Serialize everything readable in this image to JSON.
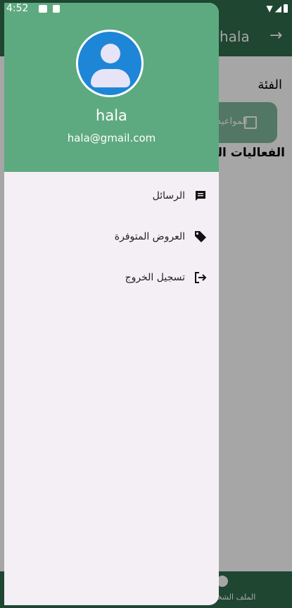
{
  "status_bar": {
    "time": "4:52"
  },
  "background_app": {
    "title": "hala",
    "category_label": "الفئة",
    "chip_label": "المواعيد",
    "events_heading": "الفعاليات القادمة",
    "bottom_nav_label": "الملف الشخصي"
  },
  "drawer": {
    "user_name": "hala",
    "user_email": "hala@gmail.com",
    "items": [
      {
        "label": "الرسائل",
        "icon": "message-icon"
      },
      {
        "label": "العروض المتوفرة",
        "icon": "tag-icon"
      },
      {
        "label": "تسجيل الخروج",
        "icon": "logout-icon"
      }
    ]
  },
  "colors": {
    "header": "#5eaa80",
    "app_bar": "#2f6c4c",
    "avatar": "#1e86d7",
    "drawer_bg": "#f4eff4"
  }
}
